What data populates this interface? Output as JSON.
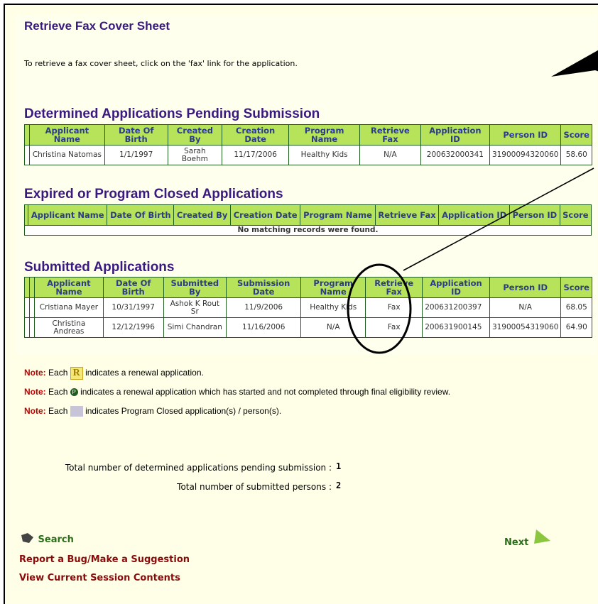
{
  "title": "Retrieve Fax Cover Sheet",
  "intro": "To retrieve a fax cover sheet, click on the 'fax' link for the application.",
  "determined": {
    "heading": "Determined Applications Pending Submission",
    "headers": [
      "Applicant Name",
      "Date Of Birth",
      "Created By",
      "Creation Date",
      "Program Name",
      "Retrieve Fax",
      "Application ID",
      "Person ID",
      "Score"
    ],
    "rows": [
      [
        "Christina Natomas",
        "1/1/1997",
        "Sarah Boehm",
        "11/17/2006",
        "Healthy Kids",
        "N/A",
        "200632000341",
        "31900094320060",
        "58.60"
      ]
    ]
  },
  "expired": {
    "heading": "Expired or Program Closed Applications",
    "headers": [
      "Applicant Name",
      "Date Of Birth",
      "Created By",
      "Creation Date",
      "Program Name",
      "Retrieve Fax",
      "Application ID",
      "Person ID",
      "Score"
    ],
    "empty_message": "No matching records were found."
  },
  "submitted": {
    "heading": "Submitted Applications",
    "headers": [
      "Applicant Name",
      "Date Of Birth",
      "Submitted By",
      "Submission Date",
      "Program Name",
      "Retrieve Fax",
      "Application ID",
      "Person ID",
      "Score"
    ],
    "rows": [
      [
        "Cristiana Mayer",
        "10/31/1997",
        "Ashok K Rout Sr",
        "11/9/2006",
        "Healthy Kids",
        "Fax",
        "200631200397",
        "N/A",
        "68.05"
      ],
      [
        "Christina Andreas",
        "12/12/1996",
        "Simi Chandran",
        "11/16/2006",
        "N/A",
        "Fax",
        "200631900145",
        "31900054319060",
        "64.90"
      ]
    ]
  },
  "notes": {
    "label": "Note:",
    "n1_pre": "Each",
    "n1_text": "indicates a renewal application.",
    "n1_badge": "R",
    "n2_pre": "Each",
    "n2_text": "indicates a renewal application which has started and not completed through final eligibility review.",
    "n2_badge": "P",
    "n3_pre": "Each",
    "n3_text": "indicates Program Closed application(s) / person(s)."
  },
  "totals": {
    "pending_label": "Total number of determined applications pending submission :",
    "pending_value": "1",
    "persons_label": "Total number of submitted persons :",
    "persons_value": "2"
  },
  "nav": {
    "search": "Search",
    "next": "Next",
    "report_bug": "Report a Bug/Make a Suggestion",
    "view_session": "View Current Session Contents"
  },
  "colors": {
    "heading": "#3a1a80",
    "header_bg": "#b7e35a",
    "link_red": "#8b0a0a",
    "link_green": "#2b6e1a"
  }
}
